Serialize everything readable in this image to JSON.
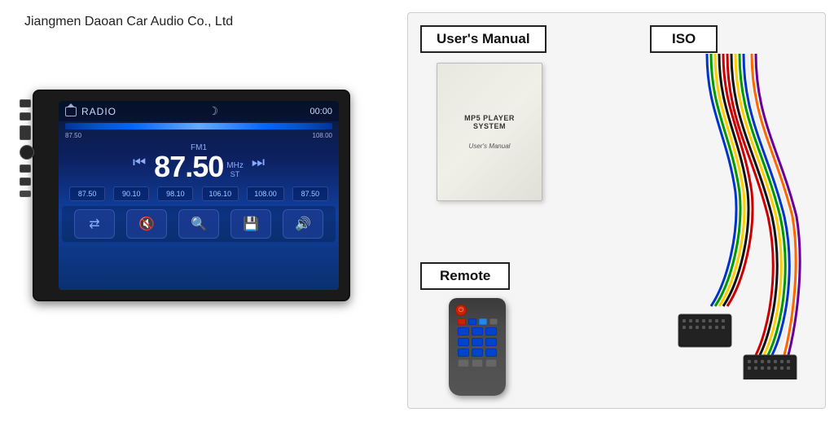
{
  "company": {
    "name": "Jiangmen Daoan Car Audio Co., Ltd"
  },
  "radio": {
    "mode": "RADIO",
    "time": "00:00",
    "freq_low": "87.50",
    "freq_high": "108.00",
    "fm": "FM1",
    "frequency": "87.50",
    "unit": "MHz",
    "st": "ST",
    "presets": [
      "87.50",
      "90.10",
      "98.10",
      "106.10",
      "108.00",
      "87.50"
    ]
  },
  "accessories": {
    "manual_label": "User's Manual",
    "iso_label": "ISO",
    "remote_label": "Remote",
    "manual_title": "MP5 PLAYER SYSTEM",
    "manual_subtitle": "User's Manual"
  }
}
